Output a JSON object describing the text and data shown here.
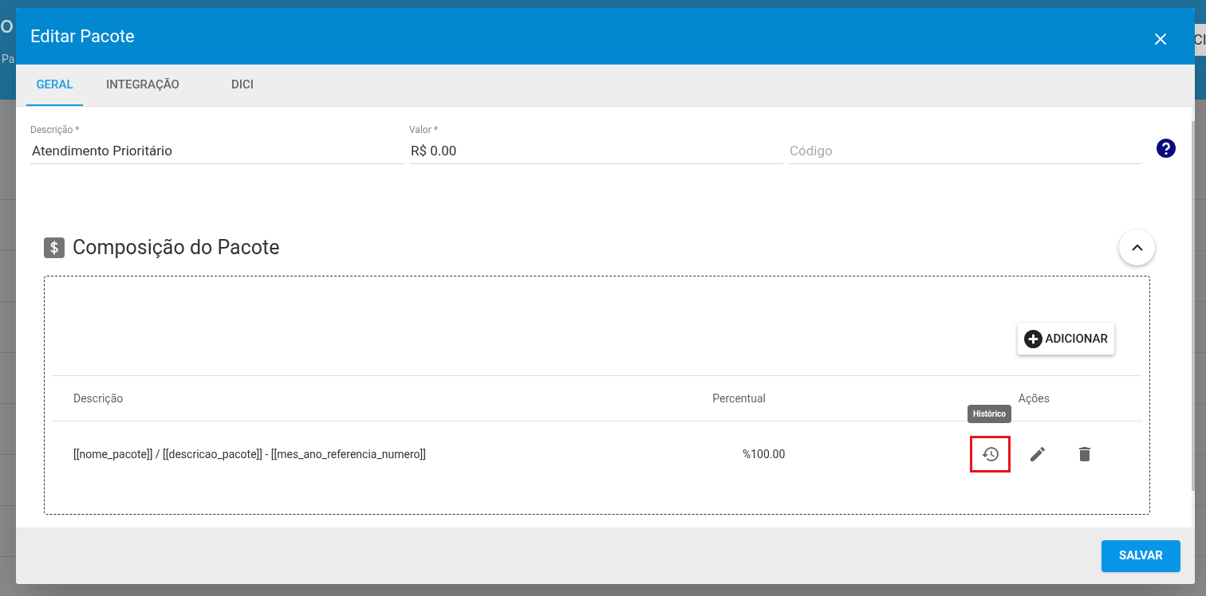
{
  "background": {
    "title": "o",
    "subtitle": "Pa",
    "button": "CI"
  },
  "dialog": {
    "title": "Editar Pacote",
    "close": "×",
    "tabs": [
      {
        "label": "GERAL",
        "selected": true
      },
      {
        "label": "INTEGRAÇÃO",
        "selected": false
      },
      {
        "label": "DICI",
        "selected": false
      }
    ],
    "fields": [
      {
        "label": "Descrição *",
        "value": "Atendimento Prioritário"
      },
      {
        "label": "Valor *",
        "value": "R$ 0.00"
      },
      {
        "placeholder": "Código"
      }
    ],
    "section": {
      "title": "Composição do Pacote",
      "expanded": true,
      "add_button": "ADICIONAR",
      "table": {
        "columns": [
          "Descrição",
          "Percentual",
          "Ações"
        ],
        "rows": [
          {
            "descricao": "[[nome_pacote]] / [[descricao_pacote]] - [[mes_ano_referencia_numero]]",
            "percentual": "%100.00",
            "actions": [
              {
                "kind": "history",
                "tooltip": "Histórico",
                "highlighted": true
              },
              {
                "kind": "edit",
                "highlighted": false
              },
              {
                "kind": "delete",
                "highlighted": false
              }
            ]
          }
        ]
      }
    },
    "save_button": "SALVAR"
  }
}
